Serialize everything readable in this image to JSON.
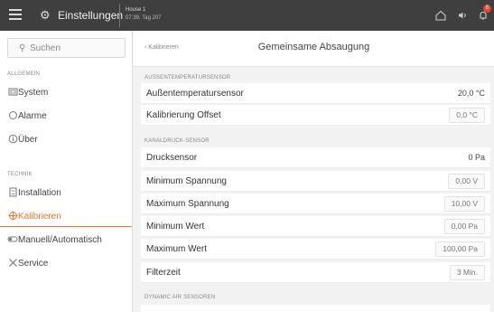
{
  "topbar": {
    "title": "Einstellungen",
    "location_name": "House 1",
    "location_time": "07:39, Tag 207",
    "notification_count": "6",
    "menu_icon": "hamburger-menu-icon",
    "settings_icon": "gear-icon",
    "home_icon": "home-icon",
    "sound_icon": "speaker-icon",
    "bell_icon": "bell-icon"
  },
  "sidebar": {
    "search_placeholder": "Suchen",
    "groups": [
      {
        "label": "ALLGEMEIN",
        "items": [
          {
            "label": "System",
            "icon": "system-icon"
          },
          {
            "label": "Alarme",
            "icon": "alarm-icon"
          },
          {
            "label": "Über",
            "icon": "info-icon"
          }
        ]
      },
      {
        "label": "TECHNIK",
        "items": [
          {
            "label": "Installation",
            "icon": "installation-icon"
          },
          {
            "label": "Kalibrieren",
            "icon": "calibrate-icon",
            "active": true
          },
          {
            "label": "Manuell/Automatisch",
            "icon": "toggle-icon"
          },
          {
            "label": "Service",
            "icon": "tools-icon"
          }
        ]
      }
    ]
  },
  "main": {
    "back_label": "Kalibrieren",
    "title": "Gemeinsame Absaugung",
    "sections": [
      {
        "label": "AUSSENTEMPERATURSENSOR",
        "rows": [
          {
            "name": "Außentemperatursensor",
            "value": "20,0 °C",
            "editable": false
          },
          {
            "name": "Kalibrierung Offset",
            "value": "0,0 °C",
            "editable": true
          }
        ]
      },
      {
        "label": "KANALDRUCK-SENSOR",
        "rows": [
          {
            "name": "Drucksensor",
            "value": "0 Pa",
            "editable": false
          },
          {
            "name": "Minimum Spannung",
            "value": "0,00 V",
            "editable": true
          },
          {
            "name": "Maximum Spannung",
            "value": "10,00 V",
            "editable": true
          },
          {
            "name": "Minimum Wert",
            "value": "0,00 Pa",
            "editable": true
          },
          {
            "name": "Maximum Wert",
            "value": "100,00 Pa",
            "editable": true
          },
          {
            "name": "Filterzeit",
            "value": "3 Min.",
            "editable": true
          }
        ]
      },
      {
        "label": "DYNAMIC AIR SENSOREN",
        "rows": []
      }
    ],
    "accent_color": "#e8732a"
  }
}
